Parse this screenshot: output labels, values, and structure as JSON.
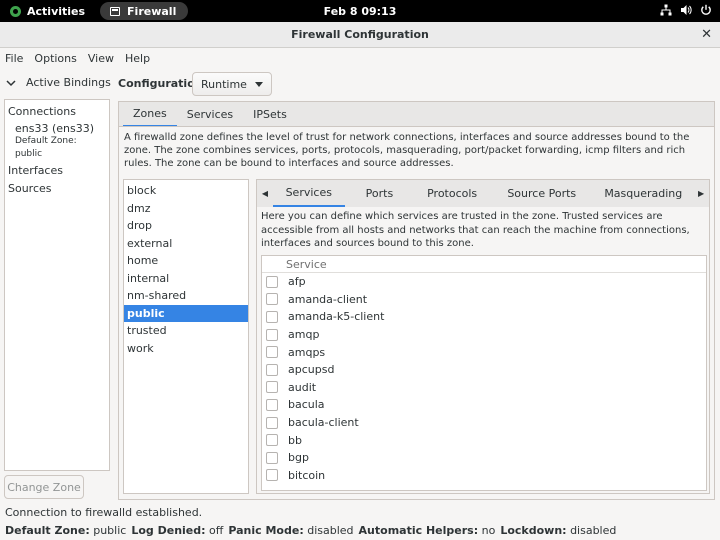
{
  "topbar": {
    "activities": "Activities",
    "app_name": "Firewall",
    "clock": "Feb 8  09:13"
  },
  "window": {
    "title": "Firewall Configuration"
  },
  "menubar": {
    "items": [
      "File",
      "Options",
      "View",
      "Help"
    ]
  },
  "sidebar": {
    "header": "Active Bindings",
    "connections_label": "Connections",
    "connection_name": "ens33 (ens33)",
    "connection_zone": "Default Zone: public",
    "interfaces_label": "Interfaces",
    "sources_label": "Sources",
    "change_zone": "Change Zone"
  },
  "config": {
    "label": "Configuration:",
    "value": "Runtime"
  },
  "main_tabs": [
    "Zones",
    "Services",
    "IPSets"
  ],
  "zone_description": "A firewalld zone defines the level of trust for network connections, interfaces and source addresses bound to the zone. The zone combines services, ports, protocols, masquerading, port/packet forwarding, icmp filters and rich rules. The zone can be bound to interfaces and source addresses.",
  "zones": [
    "block",
    "dmz",
    "drop",
    "external",
    "home",
    "internal",
    "nm-shared",
    "public",
    "trusted",
    "work"
  ],
  "selected_zone": "public",
  "sub_tabs": [
    "Services",
    "Ports",
    "Protocols",
    "Source Ports",
    "Masquerading"
  ],
  "services_description": "Here you can define which services are trusted in the zone. Trusted services are accessible from all hosts and networks that can reach the machine from connections, interfaces and sources bound to this zone.",
  "services_header": "Service",
  "services": [
    "afp",
    "amanda-client",
    "amanda-k5-client",
    "amqp",
    "amqps",
    "apcupsd",
    "audit",
    "bacula",
    "bacula-client",
    "bb",
    "bgp",
    "bitcoin"
  ],
  "status": {
    "message": "Connection to firewalld established.",
    "default_zone_label": "Default Zone:",
    "default_zone": "public",
    "log_denied_label": "Log Denied:",
    "log_denied": "off",
    "panic_mode_label": "Panic Mode:",
    "panic_mode": "disabled",
    "helpers_label": "Automatic Helpers:",
    "helpers": "no",
    "lockdown_label": "Lockdown:",
    "lockdown": "disabled"
  },
  "icons": {
    "activities": "activities-icon",
    "app": "firewall-app-icon",
    "network": "network-icon",
    "volume": "volume-icon",
    "power": "power-icon",
    "close": "close-icon",
    "chevron": "chevron-down-icon"
  },
  "colors": {
    "accent": "#3584e4",
    "topbar": "#000000"
  }
}
